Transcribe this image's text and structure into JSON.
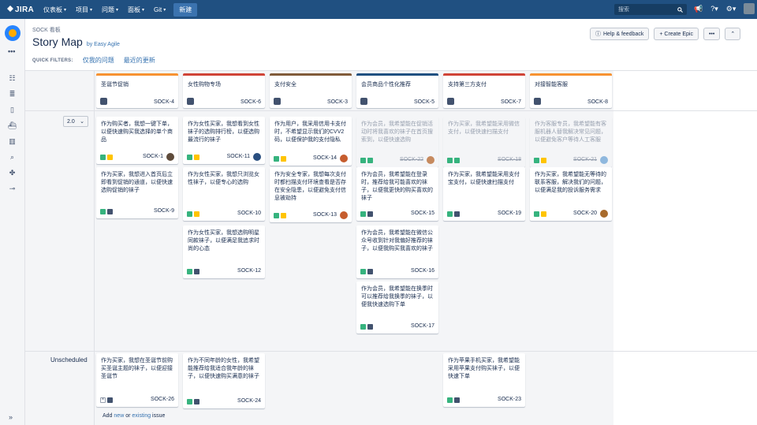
{
  "topnav": {
    "logo": "JIRA",
    "items": [
      "仪表板",
      "项目",
      "问题",
      "面板",
      "Git"
    ],
    "create": "新建",
    "search_placeholder": "搜索"
  },
  "header": {
    "project_label": "SOCK 看板",
    "title": "Story Map",
    "by": "by Easy Agile",
    "help": "Help & feedback",
    "create_epic": "+ Create Epic",
    "more": "•••",
    "collapse": "»"
  },
  "quick_filters": {
    "label": "QUICK FILTERS:",
    "filters": [
      "仅我的问题",
      "最近的更新"
    ]
  },
  "release": {
    "version": "2.0"
  },
  "unscheduled_label": "Unscheduled",
  "add_issue": {
    "pre": "Add ",
    "new": "new",
    "mid": " or ",
    "existing": "existing",
    "post": " issue"
  },
  "epics": [
    {
      "name": "圣诞节促销",
      "key": "SOCK-4",
      "color": "#f79232"
    },
    {
      "name": "女性购物专场",
      "key": "SOCK-6",
      "color": "#d04437"
    },
    {
      "name": "支付安全",
      "key": "SOCK-3",
      "color": "#815b3a"
    },
    {
      "name": "会员商品个性化推荐",
      "key": "SOCK-5",
      "color": "#205081"
    },
    {
      "name": "支持第三方支付",
      "key": "SOCK-7",
      "color": "#d04437"
    },
    {
      "name": "对接智能客服",
      "key": "SOCK-8",
      "color": "#f79232"
    }
  ],
  "cards": [
    {
      "col": 0,
      "lane": "r",
      "text": "作为购买者，我想一键下单，以便快速购买我选择的单个商品",
      "key": "SOCK-1",
      "icons": [
        "story",
        "prio"
      ],
      "avatar": "#5e4b3b"
    },
    {
      "col": 0,
      "lane": "r",
      "text": "作为买家，我想进入首页后立即看到促销的通道，以便快速选购促销的袜子",
      "key": "SOCK-9",
      "icons": [
        "story",
        "dark"
      ]
    },
    {
      "col": 1,
      "lane": "r",
      "text": "作为女性买家，我想看到女性袜子的选购排行榜，以便选购最流行的袜子",
      "key": "SOCK-11",
      "icons": [
        "story",
        "prio"
      ],
      "avatar": "#2a4f80"
    },
    {
      "col": 1,
      "lane": "r",
      "text": "作为女性买家，我想只浏览女性袜子，以便专心的选购",
      "key": "SOCK-10",
      "icons": [
        "story",
        "prio"
      ]
    },
    {
      "col": 1,
      "lane": "r",
      "text": "作为女性买家，我想选购明星同款袜子，以便满足我追求时尚的心态",
      "key": "SOCK-12",
      "icons": [
        "story",
        "dark"
      ]
    },
    {
      "col": 2,
      "lane": "r",
      "text": "作为用户，我采用信用卡支付时，不希望显示我们的CVV2码，以便保护我的支付隐私",
      "key": "SOCK-14",
      "icons": [
        "story",
        "prio"
      ],
      "avatar": "#c65d2e"
    },
    {
      "col": 2,
      "lane": "r",
      "text": "作为安全专家，我想每次支付时都扫描支付环境查看是否存在安全隐患，以便避免支付信息被劫持",
      "key": "SOCK-13",
      "icons": [
        "story",
        "prio"
      ],
      "avatar": "#c65d2e"
    },
    {
      "col": 3,
      "lane": "r",
      "text": "作为会员，我希望能在促销活动时将我喜欢的袜子在首页搜索到，以便快速选购",
      "key": "SOCK-22",
      "icons": [
        "story",
        "story"
      ],
      "avatar": "#c68a5e",
      "dim": true
    },
    {
      "col": 3,
      "lane": "r",
      "text": "作为会员，我希望能在登录时，推荐给我可能喜欢的袜子，以便我更快的购买喜欢的袜子",
      "key": "SOCK-15",
      "icons": [
        "story",
        "dark"
      ]
    },
    {
      "col": 3,
      "lane": "r",
      "text": "作为会员，我希望能在微信公众号收到针对我偏好推荐的袜子，以便我购买我喜欢的袜子",
      "key": "SOCK-16",
      "icons": [
        "story",
        "dark"
      ]
    },
    {
      "col": 3,
      "lane": "r",
      "text": "作为会员，我希望能在换季时可以推荐给我换季的袜子，以便我快速选购下单",
      "key": "SOCK-17",
      "icons": [
        "story",
        "dark"
      ]
    },
    {
      "col": 4,
      "lane": "r",
      "text": "作为买家，我希望能采用微信支付，以便快速扫描支付",
      "key": "SOCK-18",
      "icons": [
        "story",
        "story"
      ],
      "dim": true
    },
    {
      "col": 4,
      "lane": "r",
      "text": "作为买家，我希望能采用支付宝支付，以便快速扫描支付",
      "key": "SOCK-19",
      "icons": [
        "story",
        "dark"
      ]
    },
    {
      "col": 5,
      "lane": "r",
      "text": "作为客服专员，我希望能有客服机器人替我解决常见问题，以便避免客户等待人工客服",
      "key": "SOCK-21",
      "icons": [
        "story",
        "prio"
      ],
      "avatar": "#8fb8de",
      "dim": true
    },
    {
      "col": 5,
      "lane": "r",
      "text": "作为买家，我希望能无等待的联系客服，解决我们的问题，以便满足我的投诉服务需求",
      "key": "SOCK-20",
      "icons": [
        "story",
        "prio"
      ],
      "avatar": "#a86b2d"
    },
    {
      "col": 0,
      "lane": "u",
      "text": "作为买家，我想在圣诞节前购买圣诞主题的袜子，以便迎接圣诞节",
      "key": "SOCK-26",
      "icons": [
        "x",
        "dark"
      ]
    },
    {
      "col": 1,
      "lane": "u",
      "text": "作为不同年龄的女性，我希望能推荐给我适合我年龄的袜子，以便快速购买满意的袜子",
      "key": "SOCK-24",
      "icons": [
        "story",
        "dark"
      ]
    },
    {
      "col": 4,
      "lane": "u",
      "text": "作为苹果手机买家，我希望能采用苹果支付购买袜子，以便快速下单",
      "key": "SOCK-23",
      "icons": [
        "story",
        "dark"
      ]
    }
  ]
}
